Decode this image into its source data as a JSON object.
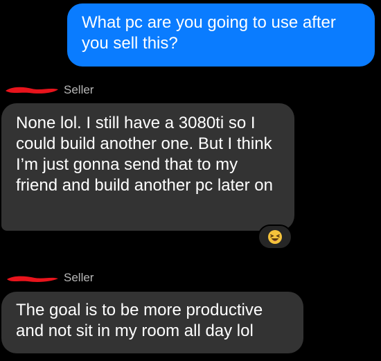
{
  "messages": [
    {
      "direction": "sent",
      "text": "What pc are you going to use after you sell this?"
    },
    {
      "direction": "received",
      "sender": "Seller",
      "text": "None lol. I still have a 3080ti so I could build another one. But I think I’m just gonna send that to my friend and build another pc later on",
      "reaction": "laughing-emoji"
    },
    {
      "direction": "received",
      "sender": "Seller",
      "text": "The goal is to be more productive and not sit in my room all day lol"
    }
  ],
  "colors": {
    "background": "#000000",
    "sent_bubble": "#0a7cff",
    "received_bubble": "#333333",
    "sender_label": "#b8b8b8",
    "redaction": "#e8141c"
  }
}
